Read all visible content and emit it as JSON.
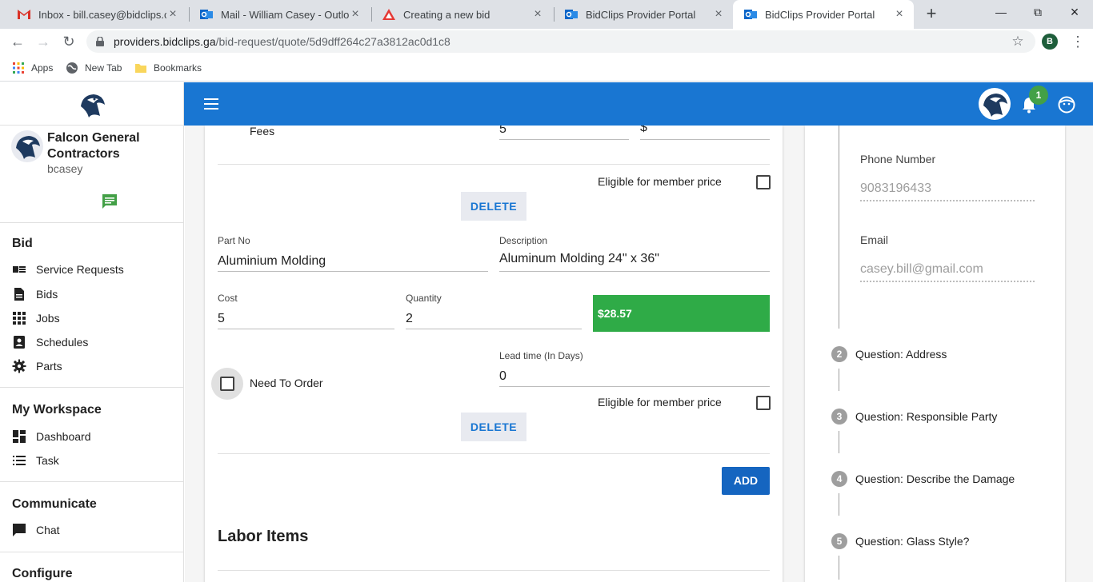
{
  "browser": {
    "tabs": [
      {
        "title": "Inbox - bill.casey@bidclips.com",
        "icon": "gmail-icon"
      },
      {
        "title": "Mail - William Casey - Outlook",
        "icon": "outlook-icon"
      },
      {
        "title": "Creating a new bid",
        "icon": "triangle-logo-icon"
      },
      {
        "title": "BidClips Provider Portal",
        "icon": "outlook-icon"
      },
      {
        "title": "BidClips Provider Portal",
        "icon": "outlook-icon",
        "active": true
      }
    ],
    "url_host": "providers.bidclips.ga",
    "url_path": "/bid-request/quote/5d9dff264c27a3812ac0d1c8",
    "profile_initial": "B",
    "bookmarks": [
      "Apps",
      "New Tab",
      "Bookmarks"
    ]
  },
  "sidebar": {
    "company_name": "Falcon General Contractors",
    "username": "bcasey",
    "sections": [
      {
        "title": "Bid",
        "items": [
          "Service Requests",
          "Bids",
          "Jobs",
          "Schedules",
          "Parts"
        ]
      },
      {
        "title": "My Workspace",
        "items": [
          "Dashboard",
          "Task"
        ]
      },
      {
        "title": "Communicate",
        "items": [
          "Chat"
        ]
      },
      {
        "title": "Configure",
        "items": []
      }
    ]
  },
  "header": {
    "notification_count": "1"
  },
  "form": {
    "fees_label": "Fees",
    "fees_value": "5",
    "fees_unit": "$",
    "part1": {
      "member_price_label": "Eligible for member price",
      "delete_label": "DELETE"
    },
    "part2": {
      "part_no_label": "Part No",
      "part_no_value": "Aluminium Molding",
      "description_label": "Description",
      "description_value": "Aluminum Molding 24\" x 36\"",
      "cost_label": "Cost",
      "cost_value": "5",
      "quantity_label": "Quantity",
      "quantity_value": "2",
      "total": "$28.57",
      "need_to_order_label": "Need To Order",
      "lead_time_label": "Lead time (In Days)",
      "lead_time_value": "0",
      "member_price_label": "Eligible for member price",
      "delete_label": "DELETE"
    },
    "add_label": "ADD",
    "labor_items_title": "Labor Items"
  },
  "details": {
    "phone_label": "Phone Number",
    "phone_value": "9083196433",
    "email_label": "Email",
    "email_value": "casey.bill@gmail.com",
    "questions": [
      {
        "num": "2",
        "label": "Question: Address"
      },
      {
        "num": "3",
        "label": "Question: Responsible Party"
      },
      {
        "num": "4",
        "label": "Question: Describe the Damage"
      },
      {
        "num": "5",
        "label": "Question: Glass Style?"
      }
    ]
  },
  "colors": {
    "appbar": "#1976d2",
    "price_box": "#2fab47",
    "badge": "#43a047",
    "chat_icon": "#43a047"
  }
}
